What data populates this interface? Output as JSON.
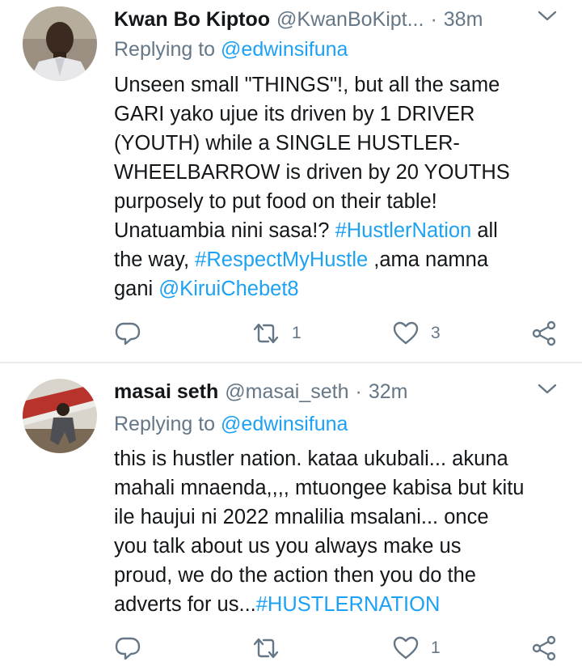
{
  "tweets": [
    {
      "name": "Kwan Bo Kiptoo",
      "handle": "@KwanBoKipt...",
      "dot": "·",
      "time": "38m",
      "reply_prefix": "Replying to",
      "reply_to": "@edwinsifuna",
      "lines": [
        [
          {
            "t": "Unseen small \"THINGS\"!, but all the same"
          }
        ],
        [
          {
            "t": "GARI yako ujue its driven by 1 DRIVER"
          }
        ],
        [
          {
            "t": "(YOUTH) while a SINGLE HUSTLER-"
          }
        ],
        [
          {
            "t": "WHEELBARROW is driven by 20 YOUTHS"
          }
        ],
        [
          {
            "t": "purposely to put food on their table!"
          }
        ],
        [
          {
            "t": "Unatuambia nini sasa!? "
          },
          {
            "t": "#HustlerNation",
            "link": true
          },
          {
            "t": " all"
          }
        ],
        [
          {
            "t": "the way, "
          },
          {
            "t": "#RespectMyHustle",
            "link": true
          },
          {
            "t": " ,ama namna"
          }
        ],
        [
          {
            "t": "gani "
          },
          {
            "t": "@KiruiChebet8",
            "link": true
          }
        ]
      ],
      "retweets": "1",
      "likes": "3",
      "icons": {
        "reply": "reply-icon",
        "retweet": "retweet-icon",
        "like": "heart-icon",
        "share": "share-icon",
        "menu": "chevron-down-icon"
      }
    },
    {
      "name": "masai seth",
      "handle": "@masai_seth",
      "dot": "·",
      "time": "32m",
      "reply_prefix": "Replying to",
      "reply_to": "@edwinsifuna",
      "lines": [
        [
          {
            "t": "this is hustler nation. kataa ukubali... akuna"
          }
        ],
        [
          {
            "t": "mahali mnaenda,,,, mtuongee kabisa but kitu"
          }
        ],
        [
          {
            "t": "ile haujui ni 2022 mnalilia  msalani... once"
          }
        ],
        [
          {
            "t": "you talk about us you always make us"
          }
        ],
        [
          {
            "t": "proud, we do the action then you do the"
          }
        ],
        [
          {
            "t": "adverts for us..."
          },
          {
            "t": "#HUSTLERNATION",
            "link": true
          }
        ]
      ],
      "retweets": "",
      "likes": "1",
      "icons": {
        "reply": "reply-icon",
        "retweet": "retweet-icon",
        "like": "heart-icon",
        "share": "share-icon",
        "menu": "chevron-down-icon"
      }
    }
  ],
  "colors": {
    "text": "#14171a",
    "secondary": "#657786",
    "link": "#1da1f2",
    "divider": "#e6ecf0"
  }
}
